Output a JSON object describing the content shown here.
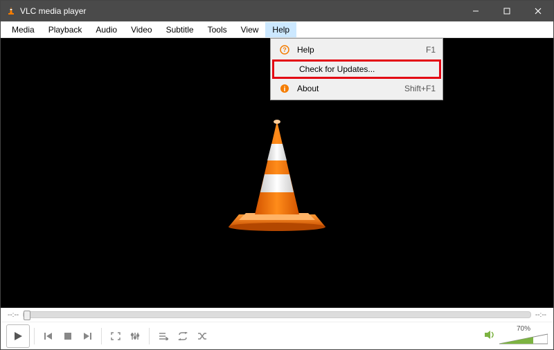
{
  "title": "VLC media player",
  "menubar": [
    "Media",
    "Playback",
    "Audio",
    "Video",
    "Subtitle",
    "Tools",
    "View",
    "Help"
  ],
  "active_menu_index": 7,
  "help_menu": {
    "items": [
      {
        "label": "Help",
        "shortcut": "F1",
        "icon": "question"
      },
      {
        "label": "Check for Updates...",
        "shortcut": "",
        "icon": "",
        "highlight": true
      },
      {
        "label": "About",
        "shortcut": "Shift+F1",
        "icon": "info"
      }
    ]
  },
  "seek": {
    "left_time": "--:--",
    "right_time": "--:--"
  },
  "volume": {
    "percent": "70%"
  }
}
